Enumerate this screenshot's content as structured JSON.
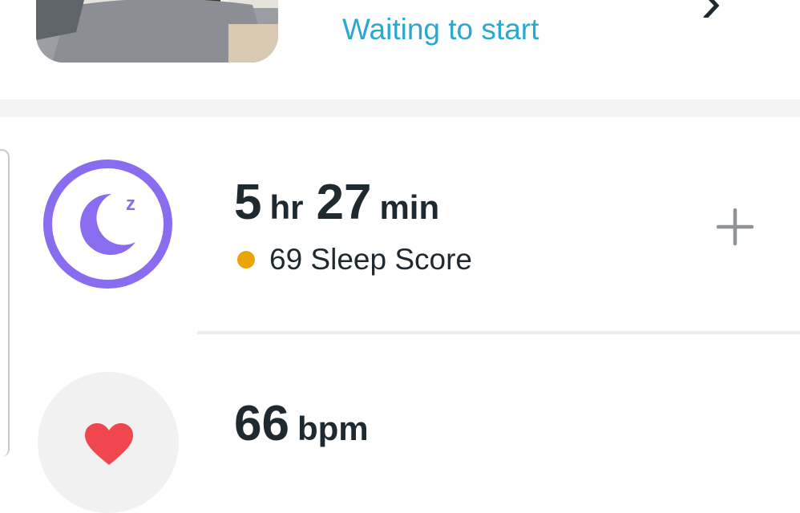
{
  "program": {
    "status": "Waiting to start"
  },
  "sleep": {
    "hours": "5",
    "hours_unit": "hr",
    "minutes": "27",
    "minutes_unit": "min",
    "score_text": "69 Sleep Score",
    "score_color": "#eaa407",
    "icon": "sleep-moon-icon",
    "accent": "#8a6cf0"
  },
  "heart_rate": {
    "value": "66",
    "unit": "bpm",
    "icon": "heart-icon",
    "accent": "#f0474f"
  },
  "actions": {
    "add_icon": "plus-icon"
  }
}
